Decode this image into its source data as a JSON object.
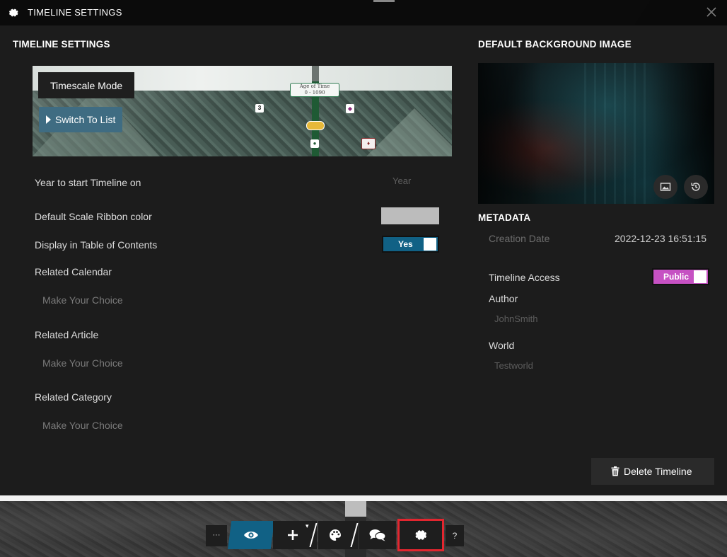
{
  "window": {
    "title": "TIMELINE SETTINGS",
    "close_icon": "close-icon"
  },
  "timeline_settings": {
    "heading": "TIMELINE SETTINGS",
    "preview": {
      "mode_label": "Timescale Mode",
      "switch_button": "Switch To List",
      "age_label_title": "Age of Time",
      "age_label_sub": "0 - 1090",
      "marker_number": "3"
    },
    "year_start": {
      "label": "Year to start Timeline on",
      "placeholder": "Year"
    },
    "ribbon_color": {
      "label": "Default Scale Ribbon color",
      "value": "#bcbcbc"
    },
    "display_toc": {
      "label": "Display in Table of Contents",
      "toggle_label": "Yes",
      "on": true
    },
    "related_calendar": {
      "label": "Related Calendar",
      "placeholder": "Make Your Choice"
    },
    "related_article": {
      "label": "Related Article",
      "placeholder": "Make Your Choice"
    },
    "related_category": {
      "label": "Related Category",
      "placeholder": "Make Your Choice"
    }
  },
  "background": {
    "heading": "DEFAULT BACKGROUND IMAGE",
    "image_button_icon": "image-icon",
    "history_button_icon": "history-icon"
  },
  "metadata": {
    "heading": "METADATA",
    "creation_date_label": "Creation Date",
    "creation_date_value": "2022-12-23 16:51:15",
    "access_label": "Timeline Access",
    "access_toggle": "Public",
    "author_label": "Author",
    "author_value": "JohnSmith",
    "world_label": "World",
    "world_value": "Testworld"
  },
  "actions": {
    "delete_label": "Delete Timeline"
  },
  "toolbar": {
    "more_label": "···",
    "help_label": "?",
    "items": [
      "eye-icon",
      "plus-icon",
      "palette-icon",
      "chat-icon",
      "gear-icon"
    ]
  },
  "colors": {
    "accent_blue": "#116185",
    "public_pink": "#c651c3",
    "highlight_red": "#e3262f"
  }
}
